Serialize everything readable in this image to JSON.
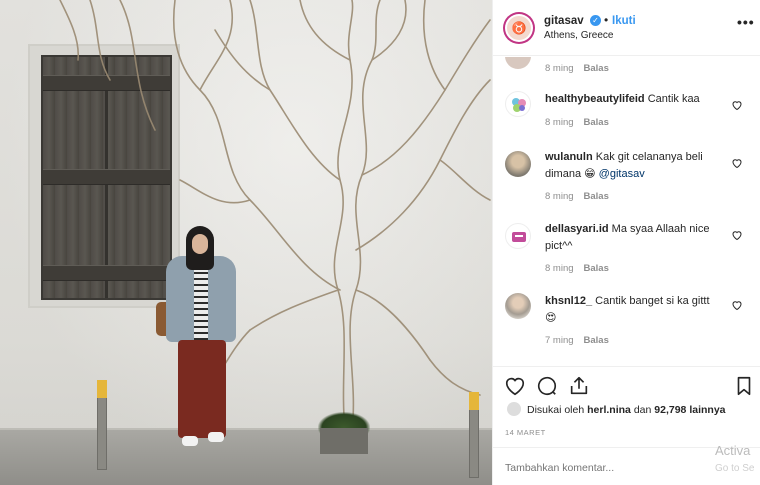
{
  "post": {
    "username": "gitasav",
    "follow_label": "Ikuti",
    "separator": "•",
    "location": "Athens, Greece",
    "more_label": "•••"
  },
  "comments": [
    {
      "user": "",
      "text": "",
      "time": "8 ming",
      "reply": "Balas",
      "heart": false
    },
    {
      "user": "healthybeautylifeid",
      "text": "Cantik kaa",
      "mention": "",
      "time": "8 ming",
      "reply": "Balas",
      "heart": true
    },
    {
      "user": "wulanuln",
      "text": "Kak git celananya beli dimana 😁",
      "mention": "@gitasav",
      "time": "8 ming",
      "reply": "Balas",
      "heart": true
    },
    {
      "user": "dellasyari.id",
      "text": "Ma syaa Allaah nice pict^^",
      "mention": "",
      "time": "8 ming",
      "reply": "Balas",
      "heart": true
    },
    {
      "user": "khsnl12_",
      "text": "Cantik banget si ka gittt 😍",
      "mention": "",
      "time": "7 ming",
      "reply": "Balas",
      "heart": true
    }
  ],
  "likes": {
    "prefix": "Disukai oleh",
    "user": "herl.nina",
    "middle": "dan",
    "count": "92,798",
    "suffix": "lainnya"
  },
  "date": "14 MARET",
  "add_comment_placeholder": "Tambahkan komentar...",
  "watermark": {
    "line1": "Activa",
    "line2": "Go to Se"
  },
  "colors": {
    "link": "#3897f0",
    "verified": "#3897f0",
    "text": "#262626",
    "muted": "#8e8e8e"
  }
}
